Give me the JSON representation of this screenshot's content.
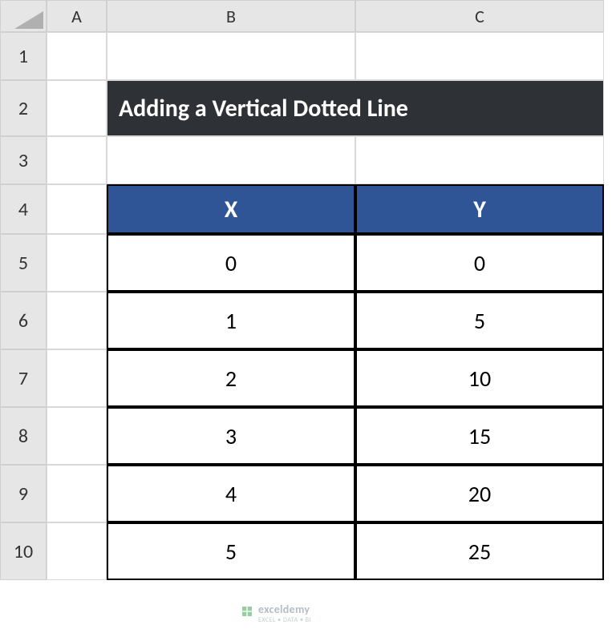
{
  "columns": [
    "A",
    "B",
    "C"
  ],
  "rows": [
    "1",
    "2",
    "3",
    "4",
    "5",
    "6",
    "7",
    "8",
    "9",
    "10"
  ],
  "title": "Adding a Vertical Dotted Line",
  "table": {
    "headers": {
      "x": "X",
      "y": "Y"
    },
    "data": [
      {
        "x": "0",
        "y": "0"
      },
      {
        "x": "1",
        "y": "5"
      },
      {
        "x": "2",
        "y": "10"
      },
      {
        "x": "3",
        "y": "15"
      },
      {
        "x": "4",
        "y": "20"
      },
      {
        "x": "5",
        "y": "25"
      }
    ]
  },
  "watermark": {
    "brand": "exceldemy",
    "tagline": "EXCEL • DATA • BI"
  },
  "chart_data": {
    "type": "table",
    "title": "Adding a Vertical Dotted Line",
    "columns": [
      "X",
      "Y"
    ],
    "rows": [
      [
        0,
        0
      ],
      [
        1,
        5
      ],
      [
        2,
        10
      ],
      [
        3,
        15
      ],
      [
        4,
        20
      ],
      [
        5,
        25
      ]
    ]
  }
}
